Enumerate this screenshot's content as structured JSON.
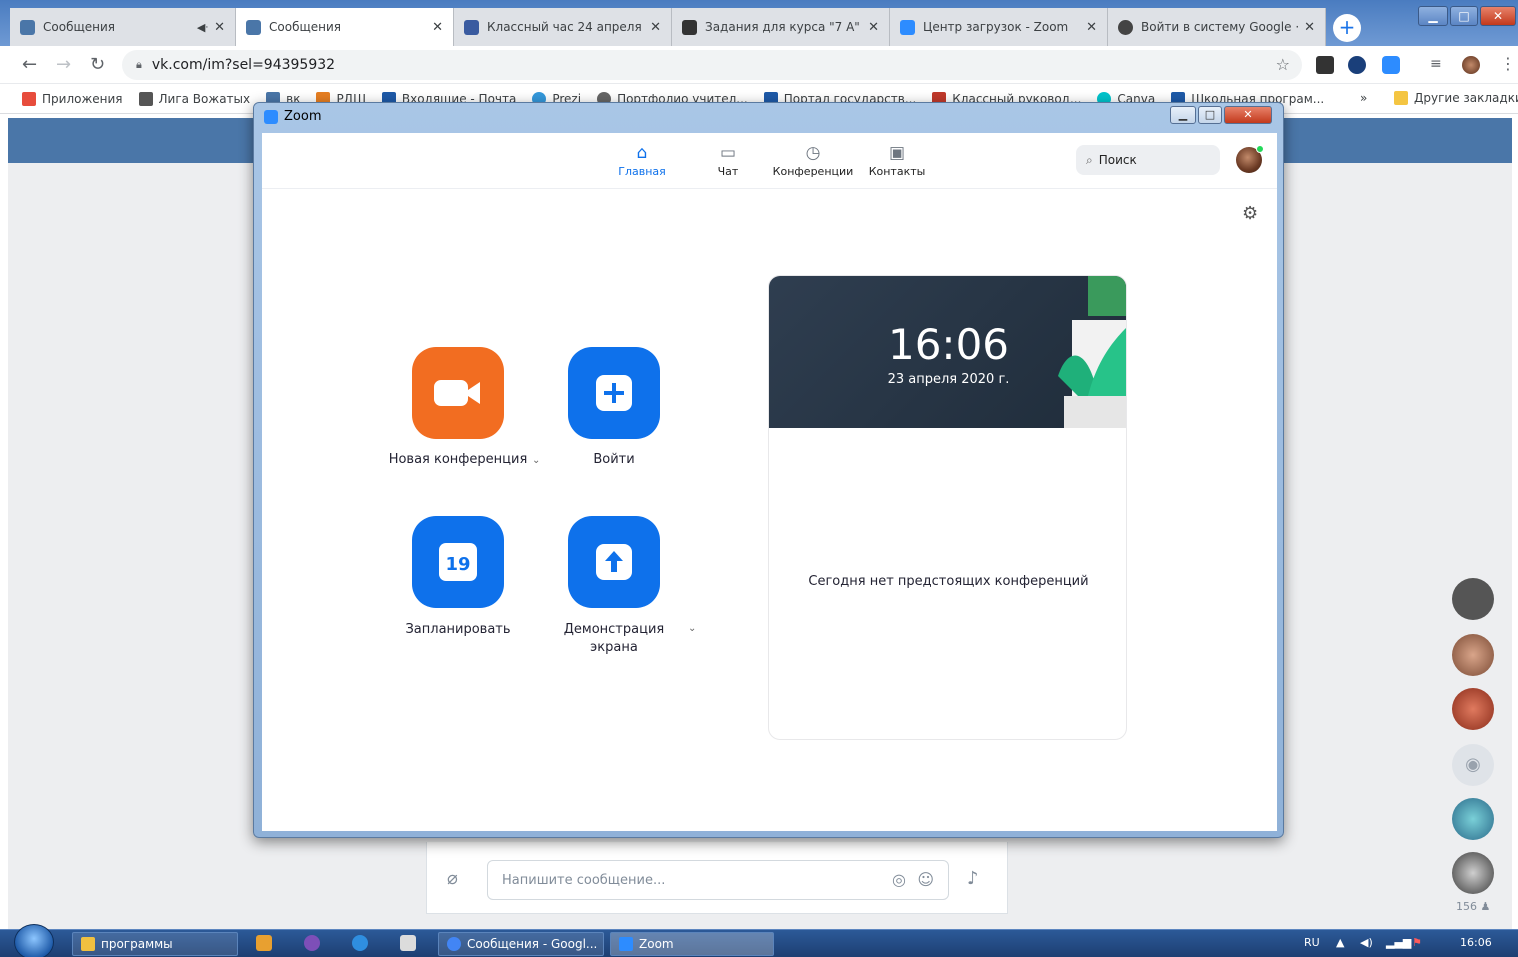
{
  "browser": {
    "tabs": [
      {
        "title": "Сообщения",
        "color": "#4a76a8",
        "active": false,
        "has_audio": true
      },
      {
        "title": "Сообщения",
        "color": "#4a76a8",
        "active": true,
        "has_audio": false
      },
      {
        "title": "Классный час 24 апреля ·",
        "color": "#3a5ba0",
        "active": false,
        "has_audio": false
      },
      {
        "title": "Задания для курса \"7 А\"",
        "color": "#333333",
        "active": false,
        "has_audio": false
      },
      {
        "title": "Центр загрузок - Zoom",
        "color": "#2d8cff",
        "active": false,
        "has_audio": false
      },
      {
        "title": "Войти в систему Google ·",
        "color": "#444444",
        "active": false,
        "has_audio": false
      }
    ],
    "url": "vk.com/im?sel=94395932",
    "bookmarks": [
      {
        "label": "Приложения",
        "color": "#e74c3c"
      },
      {
        "label": "Лига Вожатых",
        "color": "#555555"
      },
      {
        "label": "вк",
        "color": "#4a76a8"
      },
      {
        "label": "РДШ",
        "color": "#e67e22"
      },
      {
        "label": "Входящие - Почта",
        "color": "#1e5aa8"
      },
      {
        "label": "Prezi",
        "color": "#3498db"
      },
      {
        "label": "Портфолио учител...",
        "color": "#666666"
      },
      {
        "label": "Портал государств...",
        "color": "#1e5aa8"
      },
      {
        "label": "Классный руковод...",
        "color": "#c0392b"
      },
      {
        "label": "Canva",
        "color": "#00c4cc"
      },
      {
        "label": "Школьная програм...",
        "color": "#1e5aa8"
      }
    ],
    "bookmarks_more": "»",
    "other_bookmarks": "Другие закладки"
  },
  "zoom": {
    "window_title": "Zoom",
    "nav": [
      {
        "label": "Главная",
        "icon": "home-icon",
        "glyph": "⌂",
        "selected": true
      },
      {
        "label": "Чат",
        "icon": "chat-icon",
        "glyph": "▭",
        "selected": false
      },
      {
        "label": "Конференции",
        "icon": "clock-icon",
        "glyph": "◷",
        "selected": false
      },
      {
        "label": "Контакты",
        "icon": "contacts-icon",
        "glyph": "▣",
        "selected": false
      }
    ],
    "search_placeholder": "Поиск",
    "actions": {
      "new_meeting": "Новая конференция",
      "join": "Войти",
      "schedule": "Запланировать",
      "share_screen": "Демонстрация экрана",
      "calendar_day": "19"
    },
    "time": "16:06",
    "date": "23 апреля 2020 г.",
    "no_meetings": "Сегодня нет предстоящих конференций",
    "colors": {
      "orange": "#f26d21",
      "blue": "#0e71eb"
    }
  },
  "vk": {
    "message_placeholder": "Напишите сообщение...",
    "online_count": "156"
  },
  "taskbar": {
    "items": [
      {
        "label": "программы",
        "color": "#f0c040"
      },
      {
        "label": "Сообщения - Googl...",
        "color": "#4285f4"
      },
      {
        "label": "Zoom",
        "color": "#2d8cff"
      }
    ],
    "language": "RU",
    "clock": "16:06"
  }
}
